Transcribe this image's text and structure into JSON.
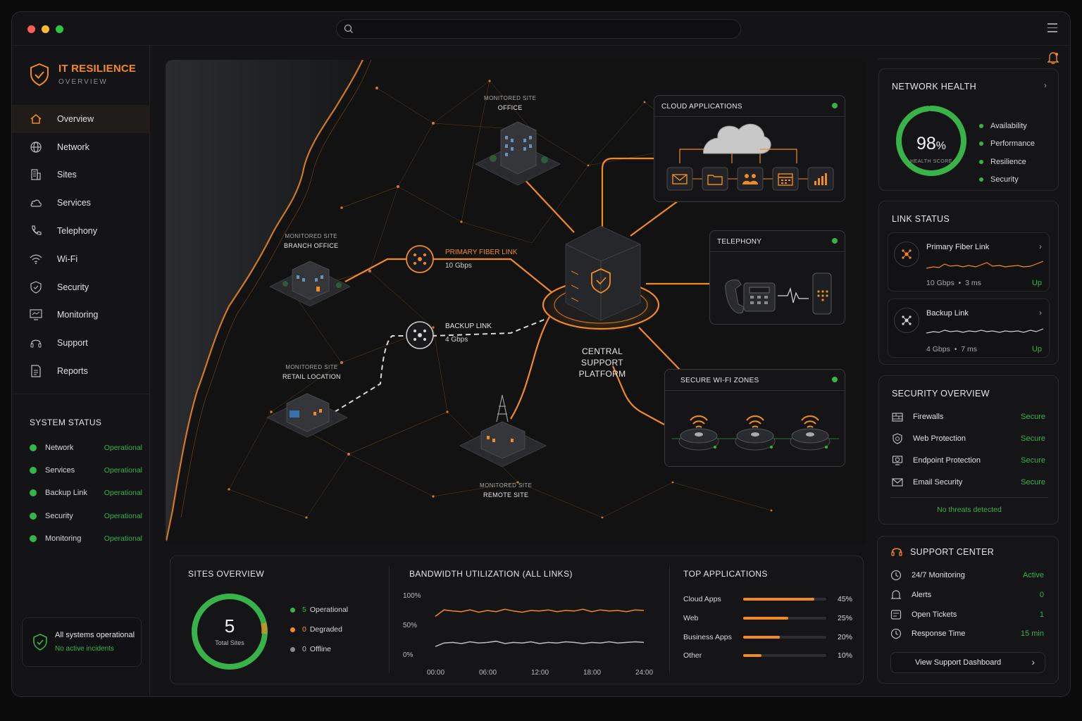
{
  "window": {
    "traffic_lights": [
      "#ff5f57",
      "#febc2e",
      "#28c840"
    ],
    "search_placeholder": ""
  },
  "brand": {
    "title": "IT RESILIENCE",
    "subtitle": "OVERVIEW",
    "accent": "#f08a24"
  },
  "nav": [
    {
      "label": "Overview",
      "icon": "home-icon",
      "active": true
    },
    {
      "label": "Network",
      "icon": "globe-icon"
    },
    {
      "label": "Sites",
      "icon": "building-icon"
    },
    {
      "label": "Services",
      "icon": "cloud-icon"
    },
    {
      "label": "Telephony",
      "icon": "phone-icon"
    },
    {
      "label": "Wi-Fi",
      "icon": "wifi-icon"
    },
    {
      "label": "Security",
      "icon": "shield-icon"
    },
    {
      "label": "Monitoring",
      "icon": "monitor-icon"
    },
    {
      "label": "Support",
      "icon": "headset-icon"
    },
    {
      "label": "Reports",
      "icon": "report-icon"
    }
  ],
  "system_status": {
    "title": "SYSTEM STATUS",
    "items": [
      {
        "name": "Network",
        "status": "Operational"
      },
      {
        "name": "Services",
        "status": "Operational"
      },
      {
        "name": "Backup Link",
        "status": "Operational"
      },
      {
        "name": "Security",
        "status": "Operational"
      },
      {
        "name": "Monitoring",
        "status": "Operational"
      }
    ],
    "summary": "All systems operational",
    "summary_sub": "No active incidents",
    "ok_color": "#37b34a"
  },
  "map": {
    "sites": {
      "office": {
        "tag": "MONITORED SITE",
        "name": "OFFICE"
      },
      "branch": {
        "tag": "MONITORED SITE",
        "name": "BRANCH OFFICE"
      },
      "retail": {
        "tag": "MONITORED SITE",
        "name": "RETAIL LOCATION"
      },
      "remote": {
        "tag": "MONITORED SITE",
        "name": "REMOTE SITE"
      }
    },
    "primary_link": {
      "label": "PRIMARY FIBER LINK",
      "speed": "10 Gbps"
    },
    "backup_link": {
      "label": "BACKUP LINK",
      "speed": "4 Gbps"
    },
    "center_label": "CENTRAL SUPPORT PLATFORM",
    "panels": {
      "cloud": "CLOUD APPLICATIONS",
      "telephony": "TELEPHONY",
      "wifi": "SECURE WI-FI ZONES"
    }
  },
  "network_health": {
    "title": "NETWORK HEALTH",
    "score": "98",
    "unit": "%",
    "score_label": "HEALTH SCORE",
    "score_value": 0.98,
    "legend": [
      "Availability",
      "Performance",
      "Resilience",
      "Security"
    ]
  },
  "link_status": {
    "title": "LINK STATUS",
    "links": [
      {
        "name": "Primary Fiber Link",
        "speed": "10 Gbps",
        "latency": "3 ms",
        "status": "Up"
      },
      {
        "name": "Backup Link",
        "speed": "4 Gbps",
        "latency": "7 ms",
        "status": "Up"
      }
    ]
  },
  "security_overview": {
    "title": "SECURITY OVERVIEW",
    "items": [
      {
        "name": "Firewalls",
        "status": "Secure",
        "icon": "firewall-icon"
      },
      {
        "name": "Web Protection",
        "status": "Secure",
        "icon": "web-shield-icon"
      },
      {
        "name": "Endpoint Protection",
        "status": "Secure",
        "icon": "endpoint-icon"
      },
      {
        "name": "Email Security",
        "status": "Secure",
        "icon": "mail-icon"
      }
    ],
    "footer": "No threats detected"
  },
  "support_center": {
    "title": "SUPPORT CENTER",
    "items": [
      {
        "name": "24/7 Monitoring",
        "value": "Active",
        "icon": "monitoring-icon"
      },
      {
        "name": "Alerts",
        "value": "0",
        "icon": "bell-icon"
      },
      {
        "name": "Open Tickets",
        "value": "1",
        "icon": "ticket-icon"
      },
      {
        "name": "Response Time",
        "value": "15 min",
        "icon": "clock-icon"
      }
    ],
    "button": "View Support Dashboard"
  },
  "sites_overview": {
    "title": "SITES OVERVIEW",
    "total": "5",
    "total_label": "Total Sites",
    "legend": [
      {
        "count": "5",
        "label": "Operational",
        "color": "#37b34a"
      },
      {
        "count": "0",
        "label": "Degraded",
        "color": "#f08a24"
      },
      {
        "count": "0",
        "label": "Offline",
        "color": "#8a8a8a"
      }
    ]
  },
  "bandwidth": {
    "title": "BANDWIDTH UTILIZATION (ALL LINKS)",
    "chart_data": {
      "type": "line",
      "x": [
        "00:00",
        "06:00",
        "12:00",
        "18:00",
        "24:00"
      ],
      "y_ticks": [
        "100%",
        "50%",
        "0%"
      ],
      "ylim": [
        0,
        100
      ],
      "series": [
        {
          "color": "#f08a24",
          "values": [
            65,
            76,
            74,
            73,
            76,
            72,
            75,
            73,
            77,
            74,
            72,
            75,
            74,
            76,
            73,
            75,
            74,
            77,
            73,
            76,
            74,
            75,
            73,
            76,
            75
          ]
        },
        {
          "color": "#bdbdbd",
          "values": [
            14,
            20,
            21,
            19,
            22,
            20,
            21,
            23,
            19,
            21,
            20,
            22,
            19,
            21,
            20,
            22,
            21,
            19,
            21,
            20,
            22,
            20,
            21,
            22,
            21
          ]
        }
      ]
    }
  },
  "top_apps": {
    "title": "TOP APPLICATIONS",
    "items": [
      {
        "name": "Cloud Apps",
        "pct": "45%",
        "value": 0.86
      },
      {
        "name": "Web",
        "pct": "25%",
        "value": 0.54
      },
      {
        "name": "Business Apps",
        "pct": "20%",
        "value": 0.44
      },
      {
        "name": "Other",
        "pct": "10%",
        "value": 0.22
      }
    ]
  }
}
